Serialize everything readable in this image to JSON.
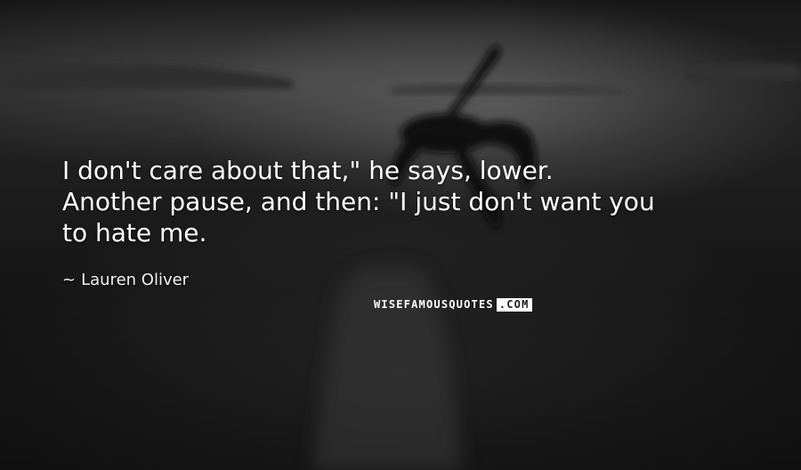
{
  "quote": {
    "line1": "I don't care about that,\" he says, lower.",
    "line2": "Another pause, and then: \"I just don't want you",
    "line3": "to hate me."
  },
  "author": {
    "dash": "~",
    "name": "Lauren Oliver"
  },
  "watermark": {
    "main": "WISEFAMOUSQUOTES",
    "suffix": ".COM"
  }
}
